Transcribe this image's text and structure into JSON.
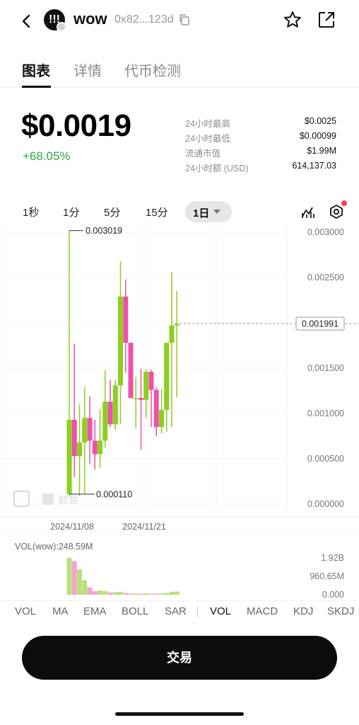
{
  "header": {
    "token_logo_text": "!!!",
    "token_name": "wow",
    "token_address": "0x82...123d",
    "back_icon": "chevron-left-icon",
    "copy_icon": "copy-icon",
    "favorite_icon": "star-outline-icon",
    "share_icon": "share-icon"
  },
  "tabs": [
    {
      "label": "图表",
      "active": true
    },
    {
      "label": "详情",
      "active": false
    },
    {
      "label": "代币检测",
      "active": false
    }
  ],
  "price": {
    "current": "$0.0019",
    "change": "+68.05%",
    "change_color": "#2fa845"
  },
  "stats": [
    {
      "label": "24小时最高",
      "value": "$0.0025"
    },
    {
      "label": "24小时最低",
      "value": "$0.00099"
    },
    {
      "label": "流通市值",
      "value": "$1.99M"
    },
    {
      "label": "24小时额 (USD)",
      "value": "614,137.03"
    }
  ],
  "intervals": [
    {
      "label": "1秒"
    },
    {
      "label": "1分"
    },
    {
      "label": "5分"
    },
    {
      "label": "15分"
    }
  ],
  "selected_interval": "1日",
  "chart_data": {
    "type": "candlestick",
    "y_ticks": [
      "0.003000",
      "0.002500",
      "0.002000",
      "0.001500",
      "0.001000",
      "0.000500",
      "0.000000"
    ],
    "y_tick_values": [
      0.003,
      0.0025,
      0.002,
      0.0015,
      0.001,
      0.0005,
      0.0
    ],
    "ylim": [
      0,
      0.003
    ],
    "x_ticks": [
      "2024/11/08",
      "2024/11/21"
    ],
    "current_price_label": "0.001991",
    "current_price": 0.001991,
    "high_annotation": "0.003019",
    "high_value": 0.003019,
    "low_annotation": "0.000110",
    "low_value": 0.00011,
    "watermark": "欧易",
    "up_color": "#8ccf1e",
    "down_color": "#f050a8",
    "candles": [
      {
        "open": 0.00011,
        "high": 0.003019,
        "low": 9e-05,
        "close": 0.00093
      },
      {
        "open": 0.00093,
        "high": 0.00177,
        "low": 0.0003,
        "close": 0.00053
      },
      {
        "open": 0.00053,
        "high": 0.0011,
        "low": 9e-05,
        "close": 0.00068
      },
      {
        "open": 0.00068,
        "high": 0.00129,
        "low": 0.00011,
        "close": 0.00095
      },
      {
        "open": 0.00095,
        "high": 0.00119,
        "low": 0.00044,
        "close": 0.0007
      },
      {
        "open": 0.0007,
        "high": 0.00093,
        "low": 0.00038,
        "close": 0.00055
      },
      {
        "open": 0.00055,
        "high": 0.00105,
        "low": 0.0004,
        "close": 0.0007
      },
      {
        "open": 0.0007,
        "high": 0.00148,
        "low": 0.00062,
        "close": 0.00113
      },
      {
        "open": 0.00113,
        "high": 0.00137,
        "low": 0.00085,
        "close": 0.00088
      },
      {
        "open": 0.00088,
        "high": 0.00137,
        "low": 0.00082,
        "close": 0.00131
      },
      {
        "open": 0.00131,
        "high": 0.00268,
        "low": 0.00089,
        "close": 0.00229
      },
      {
        "open": 0.00229,
        "high": 0.00248,
        "low": 0.00145,
        "close": 0.00178
      },
      {
        "open": 0.00178,
        "high": 0.00174,
        "low": 0.00118,
        "close": 0.00117
      },
      {
        "open": 0.00117,
        "high": 0.0014,
        "low": 0.00084,
        "close": 0.00117
      },
      {
        "open": 0.00117,
        "high": 0.00149,
        "low": 0.0006,
        "close": 0.00115
      },
      {
        "open": 0.00115,
        "high": 0.00149,
        "low": 0.00095,
        "close": 0.00146
      },
      {
        "open": 0.00146,
        "high": 0.00148,
        "low": 0.00085,
        "close": 0.00126
      },
      {
        "open": 0.00126,
        "high": 0.00129,
        "low": 0.00075,
        "close": 0.00085
      },
      {
        "open": 0.00085,
        "high": 0.00127,
        "low": 0.00078,
        "close": 0.00104
      },
      {
        "open": 0.00104,
        "high": 0.00137,
        "low": 0.0008,
        "close": 0.00178
      },
      {
        "open": 0.00178,
        "high": 0.00256,
        "low": 0.00085,
        "close": 0.00197
      },
      {
        "open": 0.00197,
        "high": 0.00235,
        "low": 0.00118,
        "close": 0.00199
      }
    ],
    "volume_title": "VOL(wow):248.59M",
    "volume_ticks": [
      "1.92B",
      "960.65M",
      "0.000"
    ],
    "volume_tick_values": [
      1920,
      960.65,
      0
    ],
    "volume_ylim": [
      0,
      1920
    ],
    "volumes": [
      1920,
      1750,
      1330,
      760,
      380,
      180,
      210,
      190,
      120,
      140,
      150,
      90,
      60,
      60,
      50,
      70,
      40,
      60,
      70,
      90,
      150,
      170
    ]
  },
  "indicators": [
    {
      "label": "VOL",
      "active": false
    },
    {
      "label": "MA",
      "active": false
    },
    {
      "label": "EMA",
      "active": false
    },
    {
      "label": "BOLL",
      "active": false
    },
    {
      "label": "SAR",
      "active": false
    },
    {
      "label": "VOL",
      "active": true
    },
    {
      "label": "MACD",
      "active": false
    },
    {
      "label": "KDJ",
      "active": false
    },
    {
      "label": "SKDJ",
      "active": false
    }
  ],
  "trade_button": "交易"
}
